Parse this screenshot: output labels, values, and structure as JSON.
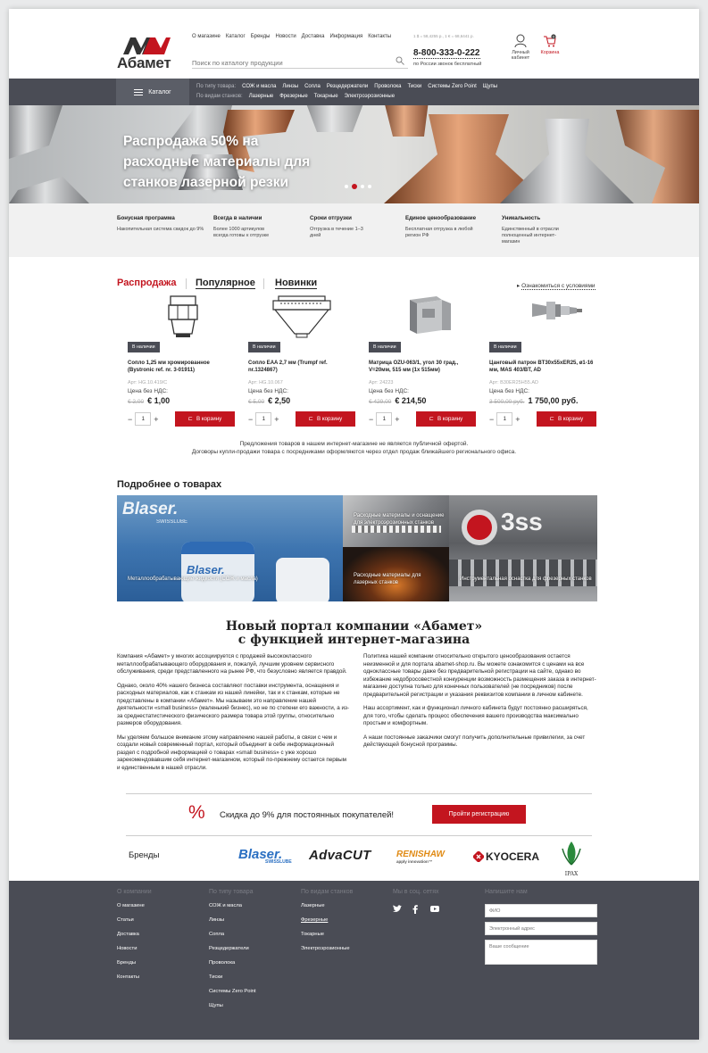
{
  "header": {
    "logo_text": "Абамет",
    "nav": [
      "О магазине",
      "Каталог",
      "Бренды",
      "Новости",
      "Доставка",
      "Информация",
      "Контакты"
    ],
    "search_placeholder": "Поиск по каталогу продукции",
    "coord_note": "1 $ = 58,4255 р., 1 € = 68,6441 р.",
    "phone": "8-800-333-0-222",
    "phone_sub": "по России звонок бесплатный",
    "account_label": "Личный кабинет",
    "cart_label": "Корзина",
    "cart_count": "0"
  },
  "navbar": {
    "catalog_label": "Каталог",
    "row1_label": "По типу товара:",
    "row1": [
      "СОЖ и масла",
      "Линзы",
      "Сопла",
      "Резцедержатели",
      "Проволока",
      "Тиски",
      "Системы Zero Point",
      "Щупы"
    ],
    "row2_label": "По видам станков:",
    "row2": [
      "Лазерные",
      "Фрезерные",
      "Токарные",
      "Электроэрозионные"
    ]
  },
  "banner": {
    "line1": "Распродажа 50% на",
    "line2": "расходные материалы для",
    "line3": "станков лазерной резки"
  },
  "features": [
    {
      "title": "Бонусная программа",
      "text": "Накопительная система скидок до 9%"
    },
    {
      "title": "Всегда в наличии",
      "text": "Более 1000 артикулов всегда готовы к отгрузке"
    },
    {
      "title": "Сроки отгрузки",
      "text": "Отгрузка в течение 1–3 дней"
    },
    {
      "title": "Единое ценообразование",
      "text": "Бесплатная отгрузка в любой регион РФ"
    },
    {
      "title": "Уникальность",
      "text": "Единственный в отрасли полноценный интернет-магазин"
    }
  ],
  "tabs": [
    "Распродажа",
    "Популярное",
    "Новинки"
  ],
  "conditions_link": "Ознакомиться с условиями",
  "products": [
    {
      "badge": "В наличии",
      "name": "Сопло 1,25 мм хромированное (Bystronic ref. nr. 3-01911)",
      "article": "Арт: HG.10.419/C",
      "nds": "Цена без НДС:",
      "old": "€ 2,00",
      "price": "€ 1,00",
      "qty": "1",
      "buy": "В корзину"
    },
    {
      "badge": "В наличии",
      "name": "Сопло EAA 2,7 мм (Trumpf ref. nr.1324867)",
      "article": "Арт: HG.10.067",
      "nds": "Цена без НДС:",
      "old": "€ 5,00",
      "price": "€ 2,50",
      "qty": "1",
      "buy": "В корзину"
    },
    {
      "badge": "В наличии",
      "name": "Матрица OZU-063/1, угол 30 град., V=20мм, 515 мм (1x 515мм)",
      "article": "Арт: 24223",
      "nds": "Цена без НДС:",
      "old": "€ 429,00",
      "price": "€ 214,50",
      "qty": "1",
      "buy": "В корзину"
    },
    {
      "badge": "В наличии",
      "name": "Цанговый патрон BT30x55xER25, ø1-16 мм, MAS 403/BT, AD",
      "article": "Арт: B30ER25H55.AD",
      "nds": "Цена без НДС:",
      "old": "3 500,00 руб.",
      "price": "1 750,00 руб.",
      "qty": "1",
      "buy": "В корзину"
    }
  ],
  "offer": {
    "line1": "Предложения товаров в нашем интернет-магазине не является публичной офертой.",
    "line2": "Договоры купли-продажи товара с посредниками оформляются через отдел продаж ближайшего регионального офиса."
  },
  "more": {
    "title": "Подробнее о товарах",
    "tiles": [
      {
        "label": "Металлообрабатывающие жидкости (СОЖ и масла)",
        "brand1": "Blaser.",
        "brand2": "SWISSLUBE"
      },
      {
        "label": "Расходные материалы и оснащение для электроэрозионных станков"
      },
      {
        "label": "Расходные материалы для лазерных станков"
      },
      {
        "label": "Инструментальная оснастка для фрезерных станков",
        "sign": "3ss"
      }
    ]
  },
  "portal": {
    "title1": "Новый портал компании «Абамет»",
    "title2": "с функцией интернет-магазина",
    "left": [
      "Компания «Абамет» у многих ассоциируется с продажей высококлассного металлообрабатывающего оборудования и, пожалуй, лучшим уровнем сервисного обслуживания, среди представленного на рынке РФ, что безусловно является правдой.",
      "Однако, около 40% нашего бизнеса составляют поставки инструмента, оснащения и расходных материалов, как к станкам из нашей линейки, так и к станкам, которые не представлены в компании «Абамет». Мы называем это направление нашей деятельности «small business» (маленький бизнес), но не по степени его важности, а из-за среднестатистического физического размера товара этой группы, относительно размеров оборудования.",
      "Мы уделяем большое внимание этому направлению нашей работы, в связи с чем и создали новый современный портал, который объединит в себе информационный раздел с подробной информацией о товарах «small business» с уже хорошо зарекомендовавшим себя интернет-магазином, который по-прежнему остается первым и единственным в нашей отрасли."
    ],
    "right": [
      "Политика нашей компании относительно открытого ценообразования остается неизменной и для портала abamet-shop.ru. Вы можете ознакомится с ценами на все одноклассные товары даже без предварительной регистрации на сайте, однако во избежание недобросовестной конкуренции возможность размещения заказа в интернет-магазине доступна только для конечных пользователей (не посредников) после предварительной регистрации и указания реквизитов компании в личном кабинете.",
      "Наш ассортимент, как и функционал личного кабинета будут постоянно расширяться, для того, чтобы сделать процесс обеспечения вашего производства максимально простым и комфортным.",
      "А наши постоянные заказчики смогут получить дополнительные привилегии, за счет действующей бонусной программы."
    ]
  },
  "discount": {
    "sign": "%",
    "text": "Скидка до 9% для постоянных покупателей!",
    "button": "Пройти регистрацию"
  },
  "brands": {
    "label": "Бренды",
    "items": [
      {
        "name": "Blaser.",
        "sub": "SWISSLUBE"
      },
      {
        "name": "AdvaCUT"
      },
      {
        "name": "RENISHAW",
        "sub": "apply innovation™"
      },
      {
        "name": "KYOCERA"
      },
      {
        "name": "IPAX"
      }
    ]
  },
  "footer": {
    "cols": [
      {
        "title": "О компании",
        "items": [
          "О магазине",
          "Статьи",
          "Доставка",
          "Новости",
          "Бренды",
          "Контакты"
        ]
      },
      {
        "title": "По типу товара",
        "items": [
          "СОЖ и масла",
          "Линзы",
          "Сопла",
          "Резцедержатели",
          "Проволока",
          "Тиски",
          "Системы Zero Point",
          "Щупы"
        ]
      },
      {
        "title": "По видам станков",
        "items": [
          "Лазерные",
          "Фрезерные",
          "Токарные",
          "Электроэрозионные"
        ]
      },
      {
        "title": "Мы в соц. сетях",
        "items": []
      },
      {
        "title": "Напишите нам",
        "items": []
      }
    ],
    "form": {
      "name": "ФИО",
      "email": "Электронный адрес",
      "message": "Ваше сообщение"
    }
  },
  "colors": {
    "accent": "#c3151f",
    "dark": "#4a4c55"
  }
}
